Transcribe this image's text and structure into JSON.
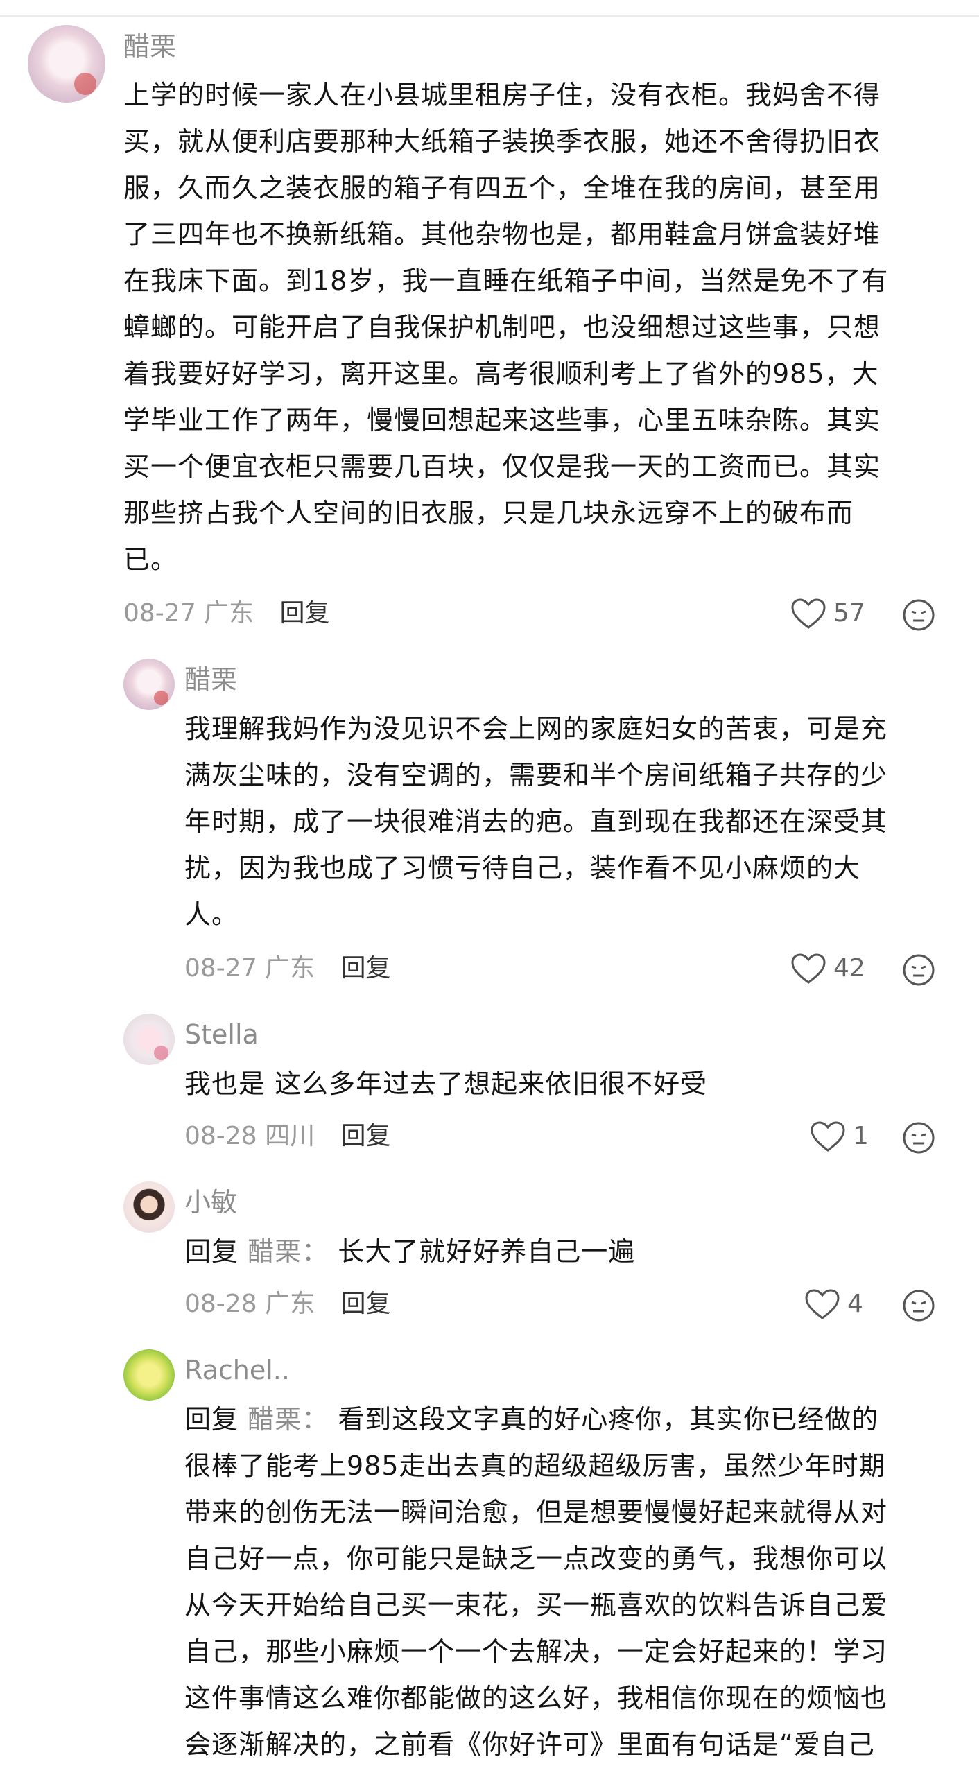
{
  "comments": [
    {
      "user": "醋栗",
      "lines": [
        "上学的时候一家人在小县城里租房子住，没有衣柜。我妈舍不得",
        "买，就从便利店要那种大纸箱子装换季衣服，她还不舍得扔旧衣",
        "服，久而久之装衣服的箱子有四五个，全堆在我的房间，甚至用",
        "了三四年也不换新纸箱。其他杂物也是，都用鞋盒月饼盒装好堆",
        "在我床下面。到18岁，我一直睡在纸箱子中间，当然是免不了有",
        "蟑螂的。可能开启了自我保护机制吧，也没细想过这些事，只想",
        "着我要好好学习，离开这里。高考很顺利考上了省外的985，大",
        "学毕业工作了两年，慢慢回想起来这些事，心里五味杂陈。其实",
        "买一个便宜衣柜只需要几百块，仅仅是我一天的工资而已。其实",
        "那些挤占我个人空间的旧衣服，只是几块永远穿不上的破布而",
        "已。"
      ],
      "date": "08-27",
      "location": "广东",
      "reply_label": "回复",
      "likes": "57"
    },
    {
      "user": "醋栗",
      "lines": [
        "我理解我妈作为没见识不会上网的家庭妇女的苦衷，可是充",
        "满灰尘味的，没有空调的，需要和半个房间纸箱子共存的少",
        "年时期，成了一块很难消去的疤。直到现在我都还在深受其",
        "扰，因为我也成了习惯亏待自己，装作看不见小麻烦的大",
        "人。"
      ],
      "date": "08-27",
      "location": "广东",
      "reply_label": "回复",
      "likes": "42"
    },
    {
      "user": "Stella",
      "lines": [
        "我也是 这么多年过去了想起来依旧很不好受"
      ],
      "date": "08-28",
      "location": "四川",
      "reply_label": "回复",
      "likes": "1"
    },
    {
      "user": "小敏",
      "reply_prefix": "回复",
      "reply_target": "醋栗：",
      "first_line_rest": "长大了就好好养自己一遍",
      "date": "08-28",
      "location": "广东",
      "reply_label": "回复",
      "likes": "4"
    },
    {
      "user": "Rachel..",
      "reply_prefix": "回复",
      "reply_target": "醋栗：",
      "first_line_rest": "看到这段文字真的好心疼你，其实你已经做的",
      "lines": [
        "很棒了能考上985走出去真的超级超级厉害，虽然少年时期",
        "带来的创伤无法一瞬间治愈，但是想要慢慢好起来就得从对",
        "自己好一点，你可能只是缺乏一点改变的勇气，我想你可以",
        "从今天开始给自己买一束花，买一瓶喜欢的饮料告诉自己爱",
        "自己，那些小麻烦一个一个去解决，一定会好起来的！学习",
        "这件事情这么难你都能做的这么好，我相信你现在的烦恼也",
        "会逐渐解决的，之前看《你好许可》里面有句话是“爱自己"
      ]
    }
  ]
}
